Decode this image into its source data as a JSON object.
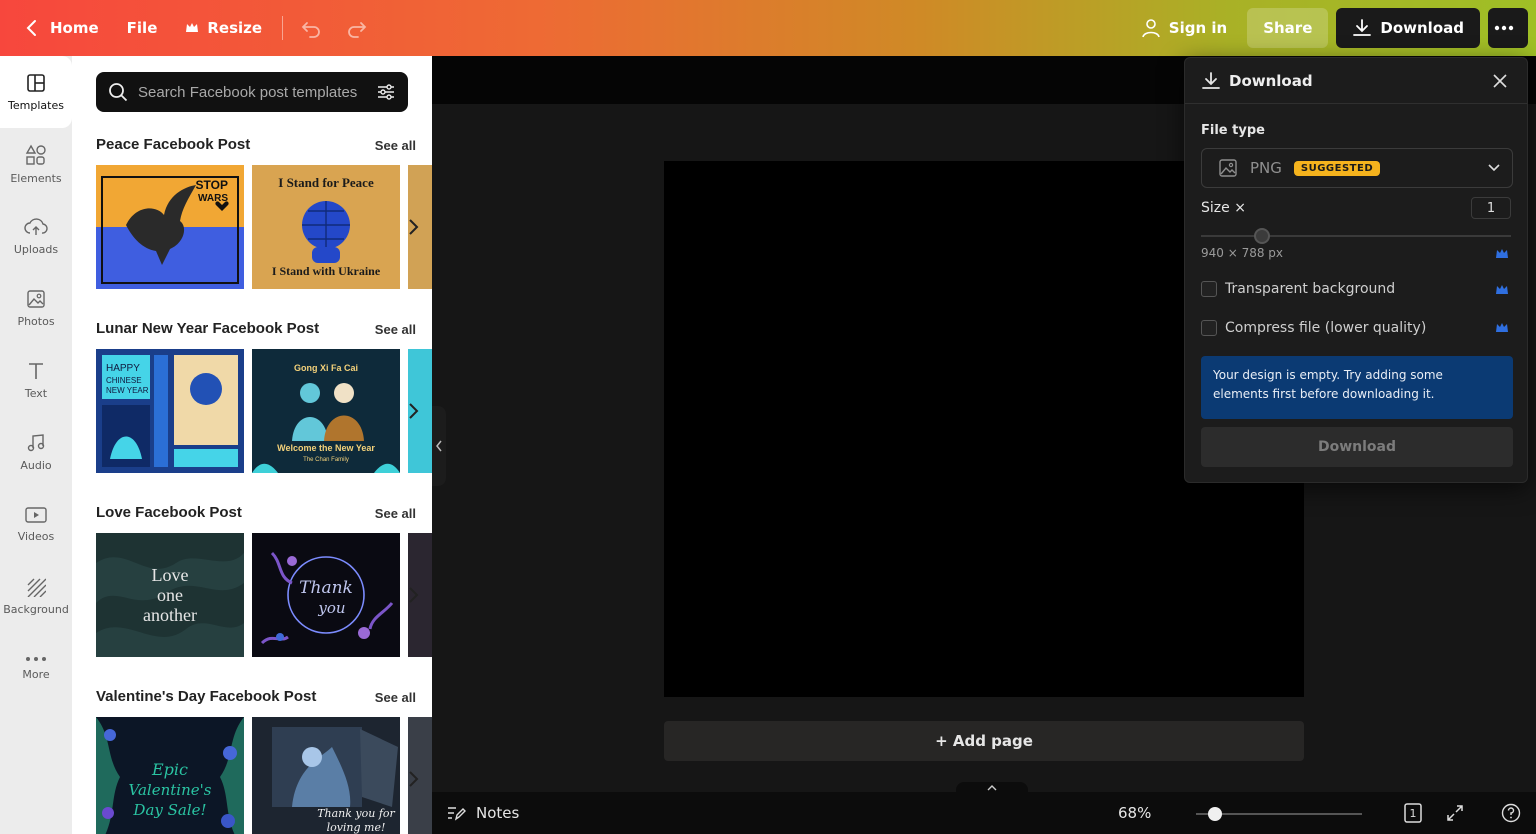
{
  "topbar": {
    "home_label": "Home",
    "file_label": "File",
    "resize_label": "Resize",
    "sign_in_label": "Sign in",
    "share_label": "Share",
    "download_label": "Download"
  },
  "rail": {
    "items": [
      {
        "label": "Templates",
        "icon": "templates-icon"
      },
      {
        "label": "Elements",
        "icon": "elements-icon"
      },
      {
        "label": "Uploads",
        "icon": "upload-icon"
      },
      {
        "label": "Photos",
        "icon": "photos-icon"
      },
      {
        "label": "Text",
        "icon": "text-icon"
      },
      {
        "label": "Audio",
        "icon": "audio-icon"
      },
      {
        "label": "Videos",
        "icon": "video-icon"
      },
      {
        "label": "Background",
        "icon": "background-icon"
      },
      {
        "label": "More",
        "icon": "more-icon"
      }
    ]
  },
  "panel": {
    "search_placeholder": "Search Facebook post templates",
    "see_all_label": "See all",
    "sections": [
      {
        "title": "Peace Facebook Post",
        "thumbs": [
          {
            "text": [
              "STOP",
              "WARS"
            ],
            "bg": "#f1a734"
          },
          {
            "text": [
              "I Stand for Peace",
              "I Stand with Ukraine"
            ],
            "bg": "#d9a451"
          }
        ]
      },
      {
        "title": "Lunar New Year Facebook Post",
        "thumbs": [
          {
            "text": [
              "HAPPY",
              "CHINESE",
              "NEW YEAR"
            ],
            "bg": "#1a3e8a"
          },
          {
            "text": [
              "Gong Xi Fa Cai",
              "Welcome the New Year",
              "The Chan Family"
            ],
            "bg": "#0e2a3a"
          }
        ]
      },
      {
        "title": "Love Facebook Post",
        "thumbs": [
          {
            "text": [
              "Love",
              "one",
              "another"
            ],
            "bg": "#1e3333"
          },
          {
            "text": [
              "Thank",
              "you"
            ],
            "bg": "#0a0a12"
          }
        ]
      },
      {
        "title": "Valentine's Day Facebook Post",
        "thumbs": [
          {
            "text": [
              "Epic",
              "Valentine's",
              "Day Sale!"
            ],
            "bg": "#0c1626"
          },
          {
            "text": [
              "Thank you for",
              "loving me!"
            ],
            "bg": "#1d2530"
          }
        ]
      }
    ]
  },
  "canvas": {
    "add_page_label": "+ Add page",
    "notes_label": "Notes",
    "zoom_label": "68%",
    "page_count": "1"
  },
  "download_popover": {
    "title": "Download",
    "file_type_label": "File type",
    "file_type_value": "PNG",
    "suggested_badge": "SUGGESTED",
    "size_label": "Size ×",
    "size_value": "1",
    "dimensions": "940 × 788 px",
    "transparent_label": "Transparent background",
    "compress_label": "Compress file (lower quality)",
    "notice": "Your design is empty. Try adding some elements first before downloading it.",
    "download_button": "Download"
  },
  "colors": {
    "accent_blue": "#2f6fe0",
    "badge_yellow": "#f5b31d",
    "notice_blue": "#0b3a73"
  }
}
